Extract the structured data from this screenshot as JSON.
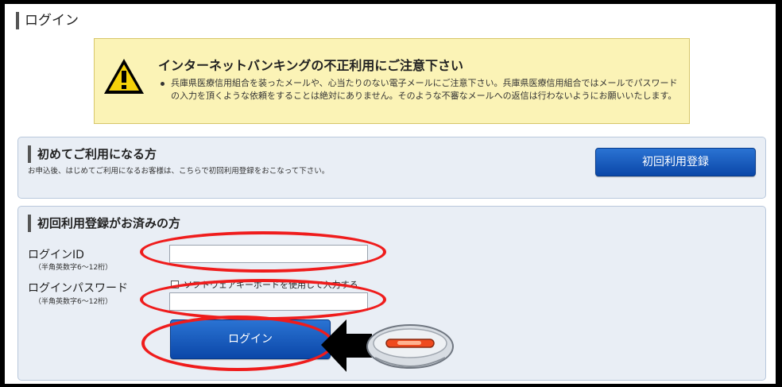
{
  "page": {
    "title": "ログイン"
  },
  "warning": {
    "icon": "warning-triangle-icon",
    "title": "インターネットバンキングの不正利用にご注意下さい",
    "lines": [
      "兵庫県医療信用組合を装ったメールや、心当たりのない電子メールにご注意下さい。兵庫県医療信用組合ではメールでパスワードの入力を頂くような依頼をすることは絶対にありません。そのような不審なメールへの返信は行わないようにお願いいたします。"
    ]
  },
  "first_time": {
    "heading": "初めてご利用になる方",
    "description": "お申込後、はじめてご利用になるお客様は、こちらで初回利用登録をおこなって下さい。",
    "register_button": "初回利用登録"
  },
  "registered": {
    "heading": "初回利用登録がお済みの方",
    "login_id_label": "ログインID",
    "login_id_hint": "（半角英数字6～12桁）",
    "login_id_value": "",
    "password_label": "ログインパスワード",
    "password_hint": "（半角英数字6～12桁）",
    "password_value": "",
    "software_keyboard_label": "ソフトウェアキーボードを使用して入力する",
    "software_keyboard_checked": false,
    "login_button": "ログイン"
  },
  "colors": {
    "warning_bg": "#fbf3b6",
    "panel_bg": "#e9eef5",
    "button_blue": "#0b47a8",
    "annotation_red": "#ef1c1c"
  },
  "annotations": {
    "pointer_icon": "mouse-icon",
    "arrow_icon": "arrow-left-icon"
  }
}
